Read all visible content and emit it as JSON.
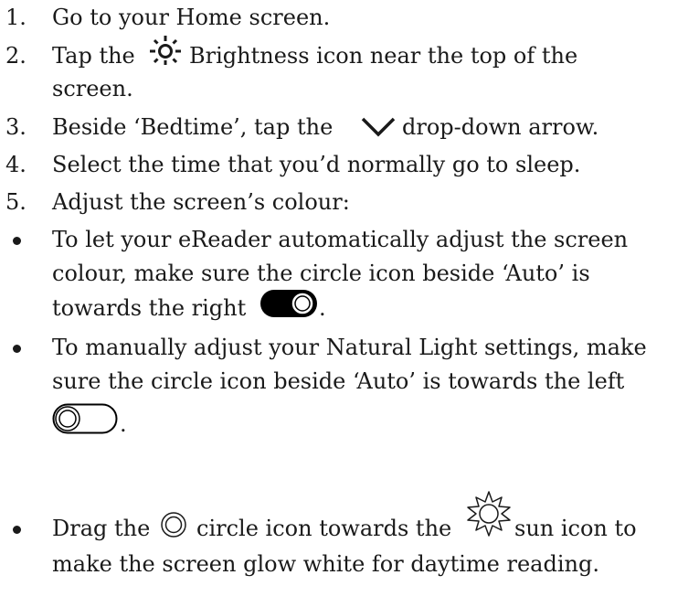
{
  "steps": [
    {
      "num": "1.",
      "text": "Go to your Home screen."
    },
    {
      "num": "2.",
      "pre": "Tap the",
      "post": "Brightness icon near the top of the",
      "cont": "screen."
    },
    {
      "num": "3.",
      "pre": "Beside ‘Bedtime’, tap the",
      "post": "drop-down arrow."
    },
    {
      "num": "4.",
      "text": "Select the time that you’d normally go to sleep."
    },
    {
      "num": "5.",
      "text": "Adjust the screen’s colour:"
    }
  ],
  "bullets": [
    {
      "l1": "To let your eReader automatically adjust the screen",
      "l2": "colour, make sure the circle icon beside ‘Auto’ is",
      "l3": "towards the right",
      "end": "."
    },
    {
      "l1": "To manually adjust your Natural Light settings, make",
      "l2": "sure the circle icon beside ‘Auto’ is towards the left",
      "end": "."
    },
    {
      "pre": "Drag the",
      "mid": "circle icon towards the",
      "post": "sun icon to",
      "l2": "make the screen glow white for daytime reading."
    }
  ],
  "icons": {
    "brightness": "brightness-icon",
    "dropdown": "chevron-down-icon",
    "toggle_on": "toggle-on-icon",
    "toggle_off": "toggle-off-icon",
    "circle": "circle-icon",
    "sun": "sun-icon"
  }
}
